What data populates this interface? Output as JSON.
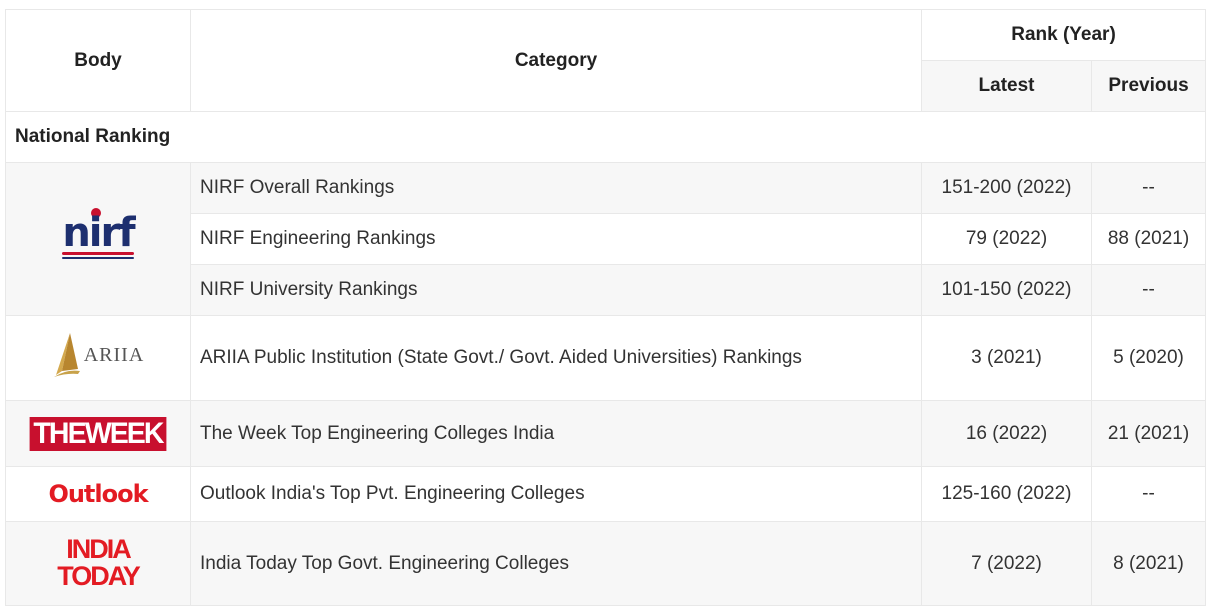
{
  "header": {
    "body": "Body",
    "category": "Category",
    "rank_year": "Rank (Year)",
    "latest": "Latest",
    "previous": "Previous"
  },
  "section": "National Ranking",
  "logos": {
    "nirf": "nirf",
    "ariia": "ARIIA",
    "week": "THEWEEK",
    "outlook": "Outlook",
    "india_today_1": "INDIA",
    "india_today_2": "TODAY"
  },
  "rows": [
    {
      "category": "NIRF Overall Rankings",
      "latest": "151-200 (2022)",
      "previous": "--"
    },
    {
      "category": "NIRF Engineering Rankings",
      "latest": "79 (2022)",
      "previous": "88 (2021)"
    },
    {
      "category": "NIRF University Rankings",
      "latest": "101-150 (2022)",
      "previous": "--"
    },
    {
      "category": "ARIIA Public Institution (State Govt./ Govt. Aided Universities) Rankings",
      "latest": "3 (2021)",
      "previous": "5 (2020)"
    },
    {
      "category": "The Week Top Engineering Colleges India",
      "latest": "16 (2022)",
      "previous": "21 (2021)"
    },
    {
      "category": "Outlook India's Top Pvt. Engineering Colleges",
      "latest": "125-160 (2022)",
      "previous": "--"
    },
    {
      "category": "India Today Top Govt. Engineering Colleges",
      "latest": "7 (2022)",
      "previous": "8 (2021)"
    }
  ],
  "colors": {
    "brand_red": "#c8102e",
    "nirf_blue": "#1d2f6f",
    "ariia_gold": "#c8a24a"
  }
}
